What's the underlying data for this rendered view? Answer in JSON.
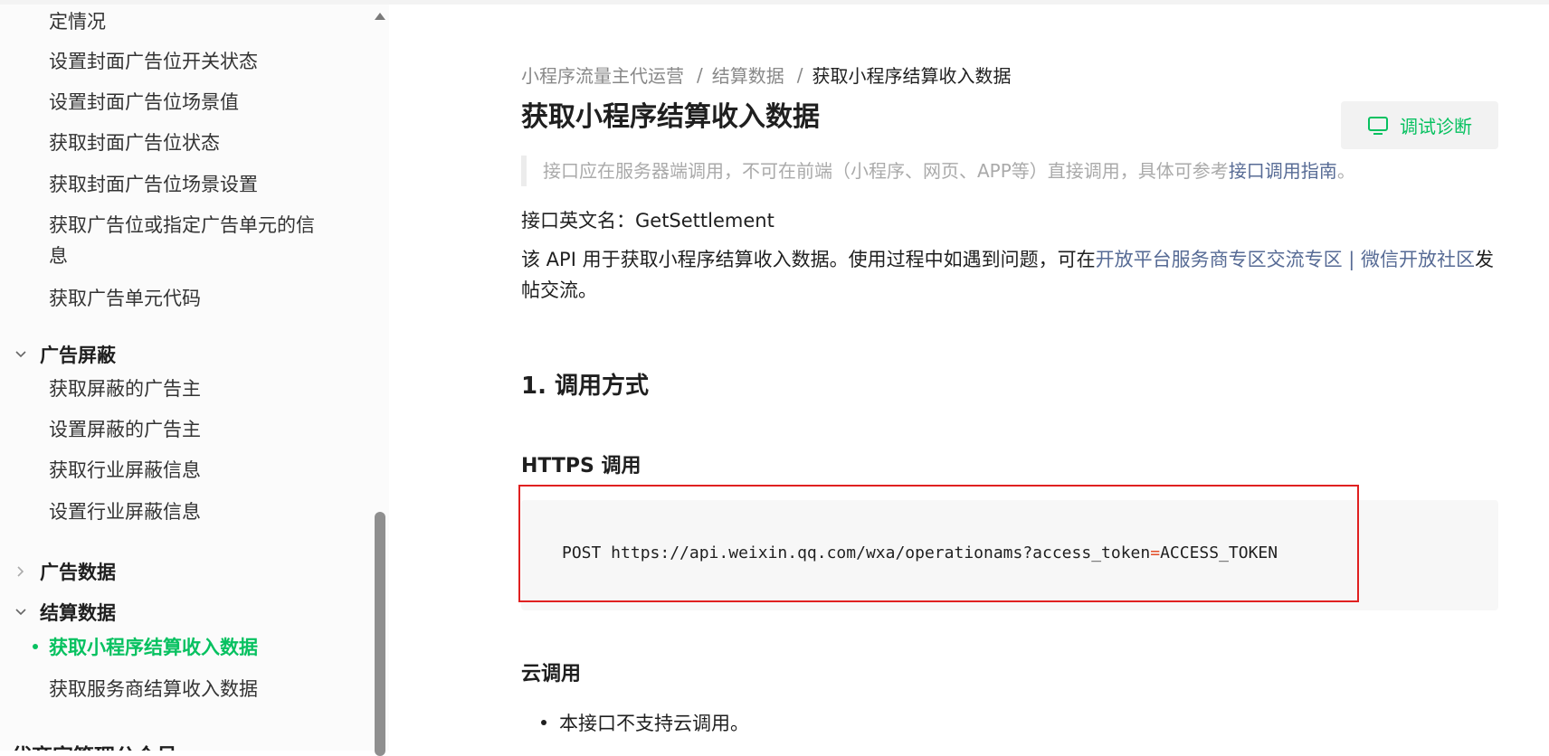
{
  "sidebar": {
    "items_top": [
      "定情况",
      "设置封面广告位开关状态",
      "设置封面广告位场景值",
      "获取封面广告位状态",
      "获取封面广告位场景设置",
      "获取广告位或指定广告单元的信息",
      "获取广告单元代码"
    ],
    "group_ad_block": "广告屏蔽",
    "items_ad_block": [
      "获取屏蔽的广告主",
      "设置屏蔽的广告主",
      "获取行业屏蔽信息",
      "设置行业屏蔽信息"
    ],
    "group_ad_data": "广告数据",
    "group_settlement": "结算数据",
    "active_item": "获取小程序结算收入数据",
    "item_service_settlement": "获取服务商结算收入数据",
    "bottom_group": "代商家管理公众号"
  },
  "breadcrumb": [
    "小程序流量主代运营",
    "结算数据",
    "获取小程序结算收入数据"
  ],
  "breadcrumb_sep": "/",
  "page_title": "获取小程序结算收入数据",
  "debug_button": "调试诊断",
  "notice": {
    "text": "接口应在服务器端调用，不可在前端（小程序、网页、APP等）直接调用，具体可参考",
    "link": "接口调用指南",
    "suffix": "。"
  },
  "api_name": "接口英文名：GetSettlement",
  "description": {
    "text": "该 API 用于获取小程序结算收入数据。使用过程中如遇到问题，可在",
    "link": "开放平台服务商专区交流专区 | 微信开放社区",
    "suffix": "发帖交流。"
  },
  "section1_title": "1. 调用方式",
  "https_title": "HTTPS 调用",
  "code": {
    "prefix": "POST https://api.weixin.qq.com/wxa/operationams?access_token",
    "op": "=",
    "suffix": "ACCESS_TOKEN"
  },
  "cloud_title": "云调用",
  "cloud_bullet": "本接口不支持云调用。",
  "colors": {
    "accent": "#07c160",
    "link": "#576b95",
    "highlight": "#e02020"
  }
}
